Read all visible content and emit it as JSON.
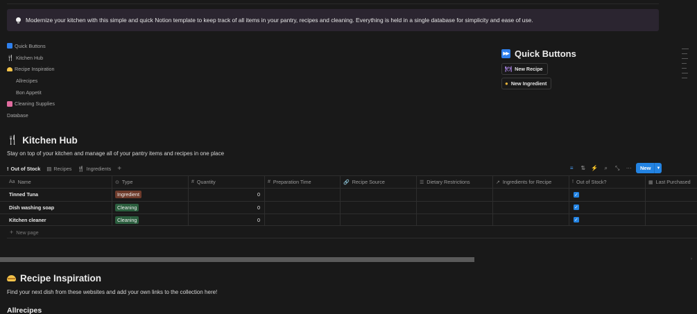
{
  "callout": {
    "text": "Modernize your kitchen with this simple and quick Notion template to keep track of all items in your pantry, recipes and cleaning. Everything is held in a single database for simplicity and ease of use."
  },
  "toc": [
    {
      "label": "Quick Buttons",
      "icon": "fast-forward-icon",
      "indent": false
    },
    {
      "label": "Kitchen Hub",
      "icon": "fork-knife-icon",
      "indent": false
    },
    {
      "label": "Recipe Inspiration",
      "icon": "bread-icon",
      "indent": false
    },
    {
      "label": "Allrecipes",
      "icon": "",
      "indent": true
    },
    {
      "label": "Bon Appetit",
      "icon": "",
      "indent": true
    },
    {
      "label": "Cleaning Supplies",
      "icon": "soap-icon",
      "indent": false
    },
    {
      "label": "Database",
      "icon": "",
      "indent": false
    }
  ],
  "quick_buttons": {
    "title": "Quick Buttons",
    "buttons": [
      {
        "label": "New Recipe",
        "icon": "plate-icon"
      },
      {
        "label": "New Ingredient",
        "icon": "egg-icon"
      }
    ]
  },
  "kitchen_hub": {
    "title": "Kitchen Hub",
    "subtitle": "Stay on top of your kitchen and manage all of your pantry items and recipes in one place",
    "tabs": [
      {
        "label": "Out of Stock",
        "icon": "!",
        "active": true
      },
      {
        "label": "Recipes",
        "icon": "▤",
        "active": false
      },
      {
        "label": "Ingredients",
        "icon": "🍴",
        "active": false
      }
    ],
    "new_button": "New"
  },
  "table": {
    "columns": [
      {
        "label": "Name",
        "icon": "Aa"
      },
      {
        "label": "Type",
        "icon": "⊙"
      },
      {
        "label": "Quantity",
        "icon": "#"
      },
      {
        "label": "Preparation Time",
        "icon": "#"
      },
      {
        "label": "Recipe Source",
        "icon": "🔗"
      },
      {
        "label": "Dietary Restrictions",
        "icon": "☰"
      },
      {
        "label": "Ingredients for Recipe",
        "icon": "↗"
      },
      {
        "label": "Out of Stock?",
        "icon": "!"
      },
      {
        "label": "Last Purchased",
        "icon": "▦"
      }
    ],
    "rows": [
      {
        "name": "Tinned Tuna",
        "type": "Ingredient",
        "quantity": "0",
        "out_of_stock": true
      },
      {
        "name": "Dish washing soap",
        "type": "Cleaning",
        "quantity": "0",
        "out_of_stock": true
      },
      {
        "name": "Kitchen cleaner",
        "type": "Cleaning",
        "quantity": "0",
        "out_of_stock": true
      }
    ],
    "new_page": "New page",
    "type_colors": {
      "Ingredient": "#6e3b2b",
      "Cleaning": "#2b5e3e"
    }
  },
  "recipe_inspiration": {
    "title": "Recipe Inspiration",
    "subtitle": "Find your next dish from these websites and add your own links to the collection here!",
    "next_heading": "Allrecipes"
  },
  "colors": {
    "background": "#191919",
    "accent": "#2383e2",
    "callout_bg": "#2b2530"
  }
}
